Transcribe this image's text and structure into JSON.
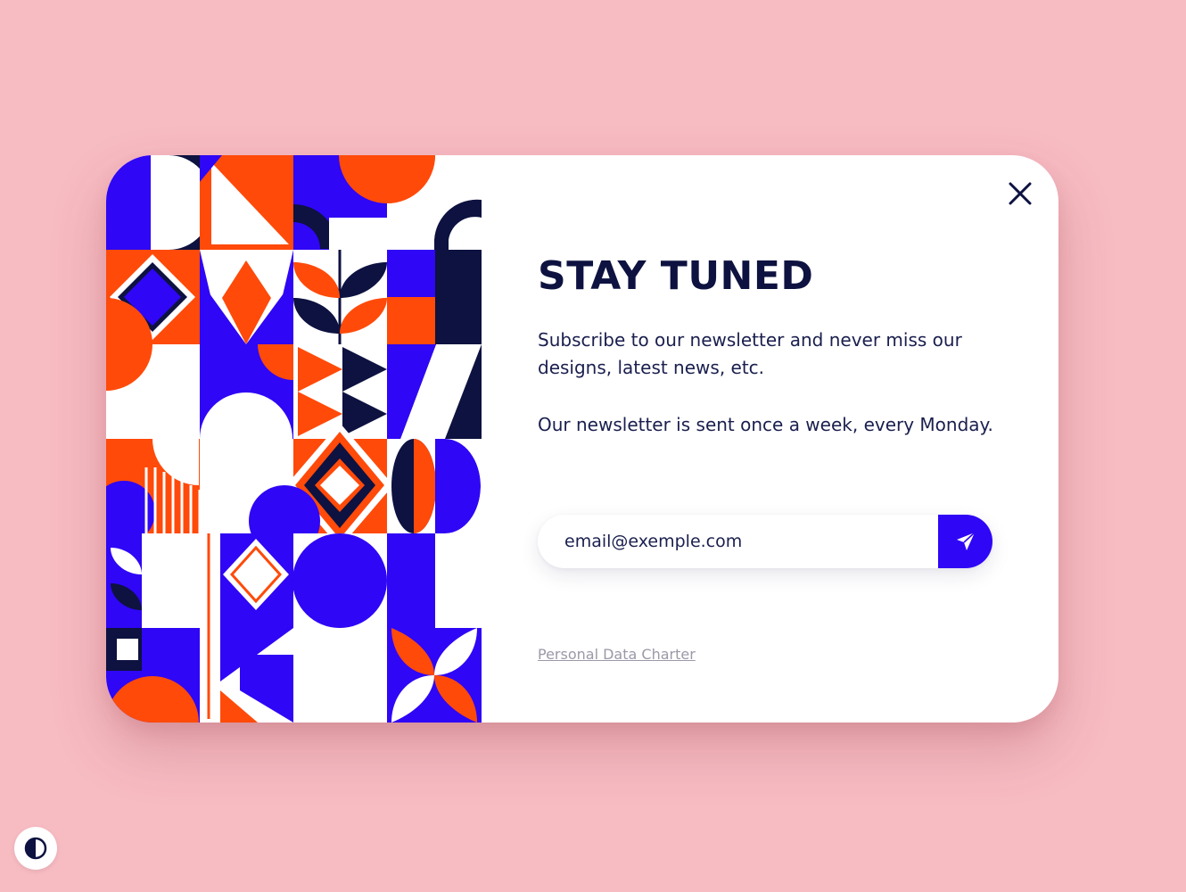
{
  "modal": {
    "title": "STAY TUNED",
    "description_1": "Subscribe to our newsletter and never miss our designs, latest news, etc.",
    "description_2": "Our newsletter is sent once a week, every Monday.",
    "email_placeholder": "email@exemple.com",
    "charter_link": "Personal Data Charter",
    "close_icon": "close-icon",
    "send_icon": "paper-plane-icon"
  },
  "theme_toggle": {
    "icon": "contrast-icon"
  },
  "colors": {
    "background": "#f7bbc2",
    "navy": "#0d1240",
    "blue": "#2f06f5",
    "orange": "#ff4a0a",
    "white": "#ffffff",
    "muted": "#9a9aa8"
  }
}
